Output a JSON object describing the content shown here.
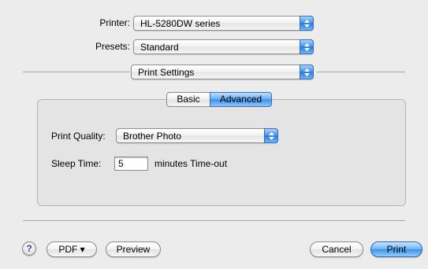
{
  "printer": {
    "label": "Printer:",
    "value": "HL-5280DW series"
  },
  "presets": {
    "label": "Presets:",
    "value": "Standard"
  },
  "section": {
    "value": "Print Settings"
  },
  "tabs": [
    {
      "label": "Basic",
      "selected": false
    },
    {
      "label": "Advanced",
      "selected": true
    }
  ],
  "print_quality": {
    "label": "Print Quality:",
    "value": "Brother Photo"
  },
  "sleep_time": {
    "label": "Sleep Time:",
    "value": "5",
    "suffix": "minutes Time-out"
  },
  "buttons": {
    "help": "?",
    "pdf": "PDF ▾",
    "preview": "Preview",
    "cancel": "Cancel",
    "print": "Print"
  },
  "colors": {
    "accent": "#3d91ea",
    "window_bg": "#ececec"
  }
}
